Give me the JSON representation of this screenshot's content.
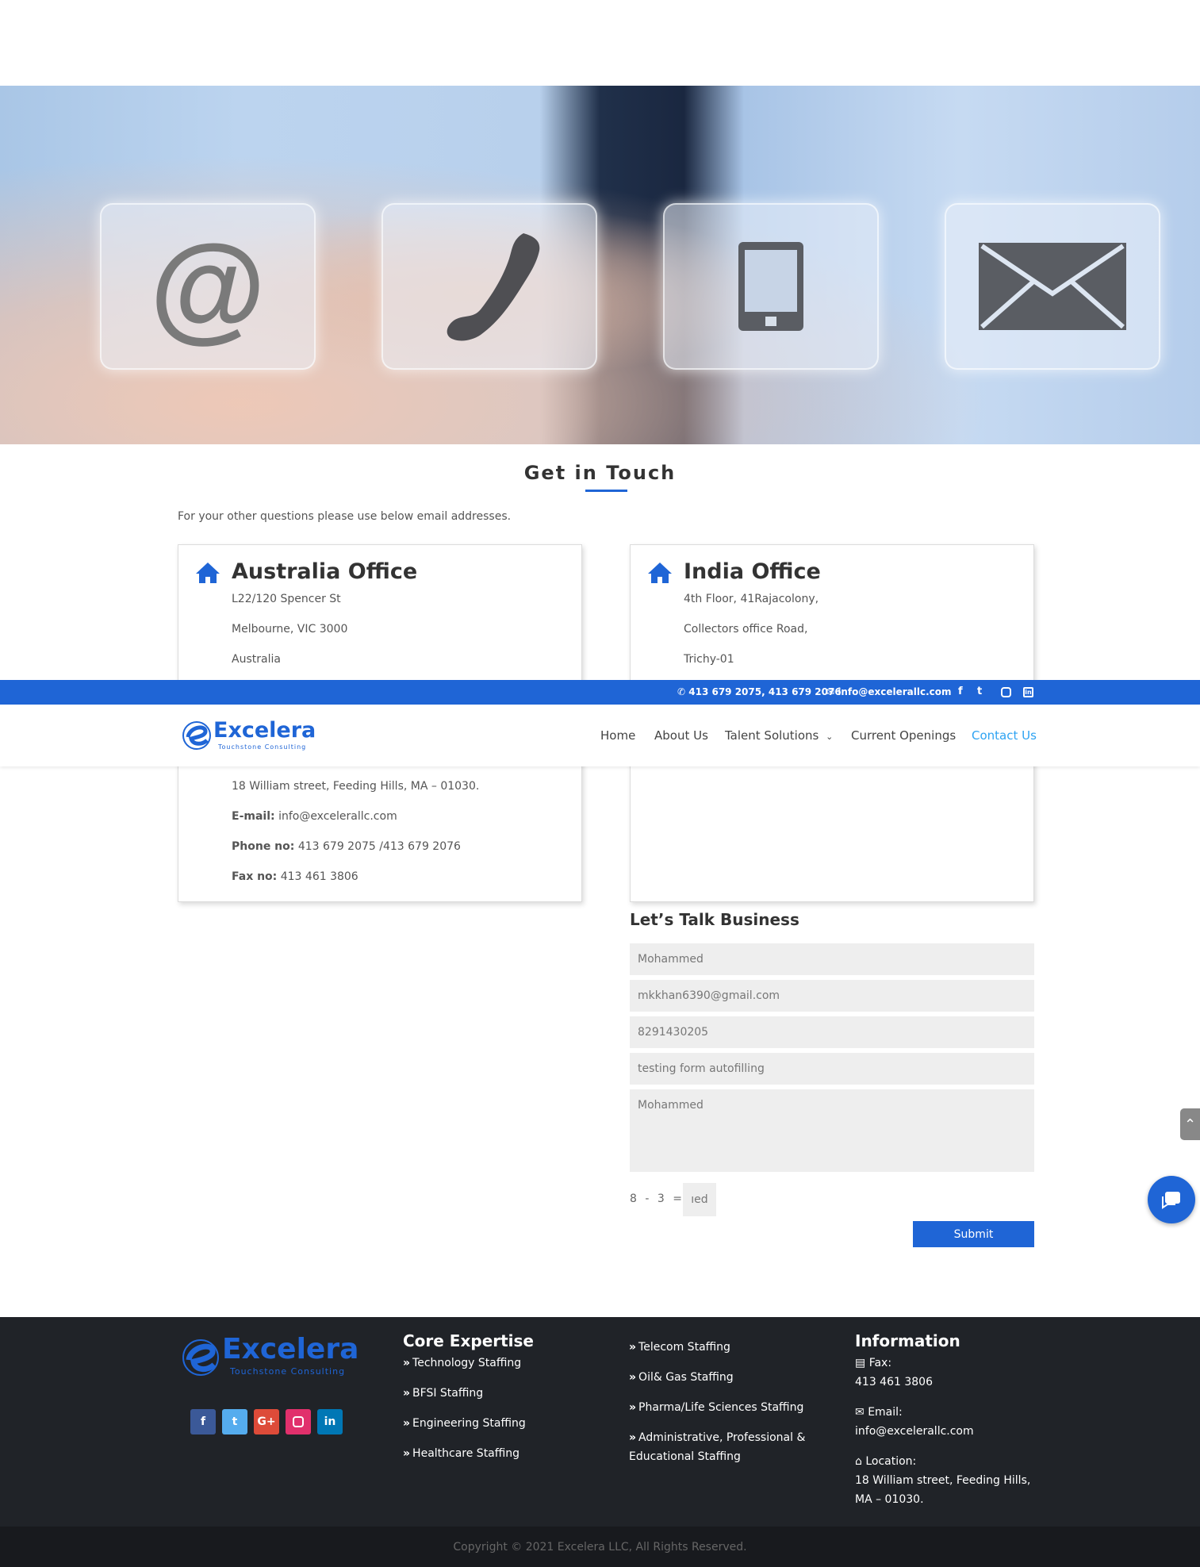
{
  "hero": {
    "icons": [
      "at-icon",
      "phone-icon",
      "tablet-icon",
      "envelope-icon"
    ]
  },
  "section": {
    "title": "Get in Touch",
    "intro": "For your other questions please use below email addresses."
  },
  "offices": {
    "australia": {
      "title": "Australia Office",
      "lines": [
        "L22/120 Spencer St",
        "Melbourne, VIC 3000",
        "Australia"
      ]
    },
    "india": {
      "title": "India Office",
      "lines": [
        "4th Floor, 41Rajacolony,",
        "Collectors office Road,",
        "Trichy-01"
      ]
    },
    "usa": {
      "address": "18 William street, Feeding Hills, MA – 01030.",
      "email_label": "E-mail:",
      "email": "info@excelerallc.com",
      "phone_label": "Phone no:",
      "phone": "413 679 2075 /413 679 2076",
      "fax_label": "Fax no:",
      "fax": "413 461 3806"
    }
  },
  "topbar": {
    "phones": "413 679 2075, 413 679 2076",
    "email": "info@excelerallc.com",
    "social": [
      "f",
      "t",
      "ig",
      "in"
    ]
  },
  "header": {
    "logo_text": "Excelera",
    "logo_sub": "Touchstone Consulting",
    "nav": [
      "Home",
      "About Us",
      "Talent Solutions",
      "Current Openings",
      "Contact Us"
    ],
    "active": "Contact Us",
    "colors": {
      "brand": "#1f65d6",
      "active": "#2ea3f2"
    }
  },
  "form": {
    "title": "Let’s Talk Business",
    "name": "Mohammed",
    "email": "mkkhan6390@gmail.com",
    "phone": "8291430205",
    "subject": "testing form autofilling",
    "message": "Mohammed",
    "captcha": "8 - 3 =",
    "captcha_value": "ıed",
    "submit": "Submit"
  },
  "footer": {
    "logo_text": "Excelera",
    "logo_sub": "Touchstone Consulting",
    "social": [
      "f",
      "t",
      "G+",
      "ig",
      "in"
    ],
    "core_title": "Core Expertise",
    "core_col1": [
      "Technology Staffing",
      "BFSI Staffing",
      "Engineering Staffing",
      "Healthcare Staffing"
    ],
    "core_col2": [
      "Telecom Staffing",
      "Oil& Gas Staffing",
      "Pharma/Life Sciences Staffing",
      "Administrative, Professional & Educational Staffing"
    ],
    "info_title": "Information",
    "fax_label": "Fax:",
    "fax": "413 461 3806",
    "email_label": "Email:",
    "email": "info@excelerallc.com",
    "location_label": "Location:",
    "location": "18 William street, Feeding Hills, MA – 01030.",
    "copyright": "Copyright © 2021 Excelera LLC, All Rights Reserved."
  }
}
